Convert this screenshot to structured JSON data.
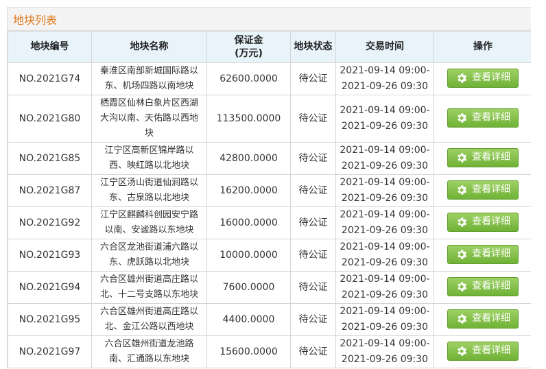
{
  "panel": {
    "title": "地块列表"
  },
  "table": {
    "headers": {
      "code": "地块编号",
      "name": "地块名称",
      "deposit_line1": "保证金",
      "deposit_line2": "(万元)",
      "status": "地块状态",
      "time": "交易时间",
      "action": "操作"
    },
    "rows": [
      {
        "code": "NO.2021G74",
        "name": "秦淮区南部新城国际路以东、机场四路以南地块",
        "deposit": "62600.0000",
        "status": "待公证",
        "time_start": "2021-09-14 09:00-",
        "time_end": "2021-09-26 09:30",
        "button": "查看详细"
      },
      {
        "code": "NO.2021G80",
        "name": "栖霞区仙林白象片区西湖大沟以南、天佑路以西地块",
        "deposit": "113500.0000",
        "status": "待公证",
        "time_start": "2021-09-14 09:00-",
        "time_end": "2021-09-26 09:30",
        "button": "查看详细"
      },
      {
        "code": "NO.2021G85",
        "name": "江宁区高新区锦岸路以西、映红路以北地块",
        "deposit": "42800.0000",
        "status": "待公证",
        "time_start": "2021-09-14 09:00-",
        "time_end": "2021-09-26 09:30",
        "button": "查看详细"
      },
      {
        "code": "NO.2021G87",
        "name": "江宁区汤山街道仙涧路以东、古泉路以北地块",
        "deposit": "16200.0000",
        "status": "待公证",
        "time_start": "2021-09-14 09:00-",
        "time_end": "2021-09-26 09:30",
        "button": "查看详细"
      },
      {
        "code": "NO.2021G92",
        "name": "江宁区麒麟科创园安宁路以南、安谧路以东地块",
        "deposit": "16000.0000",
        "status": "待公证",
        "time_start": "2021-09-14 09:00-",
        "time_end": "2021-09-26 09:30",
        "button": "查看详细"
      },
      {
        "code": "NO.2021G93",
        "name": "六合区龙池街道浦六路以东、虎跃路以北地块",
        "deposit": "10000.0000",
        "status": "待公证",
        "time_start": "2021-09-14 09:00-",
        "time_end": "2021-09-26 09:30",
        "button": "查看详细"
      },
      {
        "code": "NO.2021G94",
        "name": "六合区雄州街道高庄路以北、十二号支路以东地块",
        "deposit": "7600.0000",
        "status": "待公证",
        "time_start": "2021-09-14 09:00-",
        "time_end": "2021-09-26 09:30",
        "button": "查看详细"
      },
      {
        "code": "NO.2021G95",
        "name": "六合区雄州街道高庄路以北、金江公路以西地块",
        "deposit": "4400.0000",
        "status": "待公证",
        "time_start": "2021-09-14 09:00-",
        "time_end": "2021-09-26 09:30",
        "button": "查看详细"
      },
      {
        "code": "NO.2021G97",
        "name": "六合区雄州街道龙池路南、汇通路以东地块",
        "deposit": "15600.0000",
        "status": "待公证",
        "time_start": "2021-09-14 09:00-",
        "time_end": "2021-09-26 09:30",
        "button": "查看详细"
      }
    ]
  },
  "icons": {
    "button_icon": "gear-icon"
  },
  "colors": {
    "title": "#e07a1a",
    "header_bg": "#e8f4fa",
    "button": "#7cbc3e"
  }
}
